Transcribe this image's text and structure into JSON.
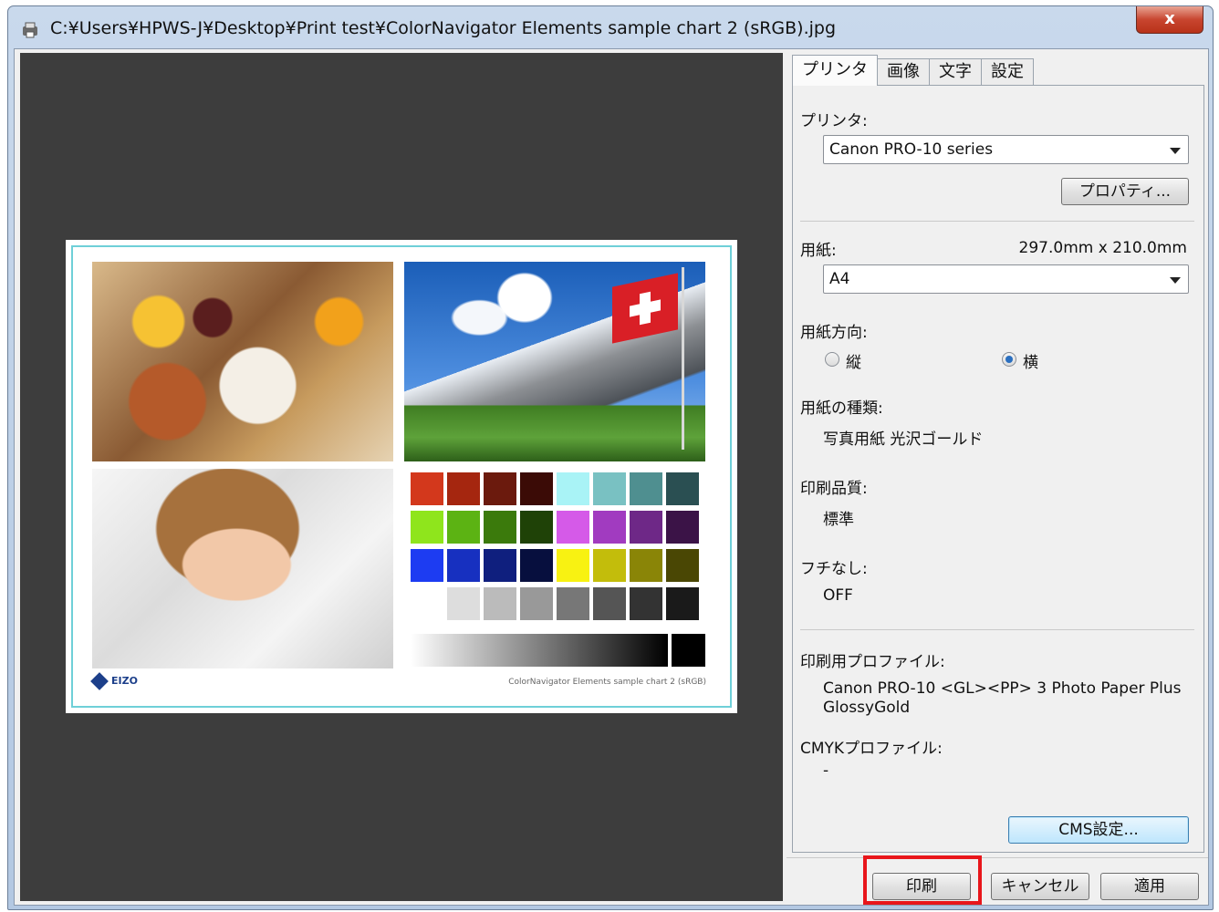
{
  "window": {
    "title": "C:¥Users¥HPWS-J¥Desktop¥Print test¥ColorNavigator Elements sample chart 2 (sRGB).jpg",
    "close_label": "x"
  },
  "preview": {
    "chart_caption": "ColorNavigator Elements sample chart 2 (sRGB)",
    "logo_text": "EIZO"
  },
  "tabs": [
    {
      "label": "プリンタ"
    },
    {
      "label": "画像"
    },
    {
      "label": "文字"
    },
    {
      "label": "設定"
    }
  ],
  "printer": {
    "label": "プリンタ:",
    "selected": "Canon PRO-10 series",
    "properties_button": "プロパティ..."
  },
  "paper": {
    "label": "用紙:",
    "size_text": "297.0mm x 210.0mm",
    "selected": "A4"
  },
  "orientation": {
    "label": "用紙方向:",
    "portrait": "縦",
    "landscape": "横",
    "selected": "landscape"
  },
  "paper_type": {
    "label": "用紙の種類:",
    "value": "写真用紙 光沢ゴールド"
  },
  "quality": {
    "label": "印刷品質:",
    "value": "標準"
  },
  "borderless": {
    "label": "フチなし:",
    "value": "OFF"
  },
  "print_profile": {
    "label": "印刷用プロファイル:",
    "value_line1": "Canon PRO-10 <GL><PP> 3 Photo Paper Plus",
    "value_line2": "GlossyGold"
  },
  "cmyk_profile": {
    "label": "CMYKプロファイル:",
    "value": "-"
  },
  "buttons": {
    "cms": "CMS設定...",
    "print": "印刷",
    "cancel": "キャンセル",
    "apply": "適用"
  },
  "colors": {
    "highlight": "#e8161b",
    "preview_background": "#3d3d3d"
  },
  "swatch_colors": [
    [
      "#d3381c",
      "#a5260f",
      "#6b1a0d",
      "#3b0b06",
      "#a9f3f6",
      "#79c1c2",
      "#4f8f90",
      "#2a4f52"
    ],
    [
      "#8fe51c",
      "#5cb313",
      "#3b7a0c",
      "#1f4207",
      "#d55ae8",
      "#a13bc0",
      "#6e2887",
      "#3b1347"
    ],
    [
      "#1d3cf2",
      "#1730c0",
      "#0f1f7e",
      "#070f3e",
      "#f8f212",
      "#c3bd0b",
      "#8a8507",
      "#4a4704"
    ],
    [
      "#ffffff",
      "#dddddd",
      "#bbbbbb",
      "#999999",
      "#777777",
      "#555555",
      "#333333",
      "#1a1a1a"
    ]
  ]
}
